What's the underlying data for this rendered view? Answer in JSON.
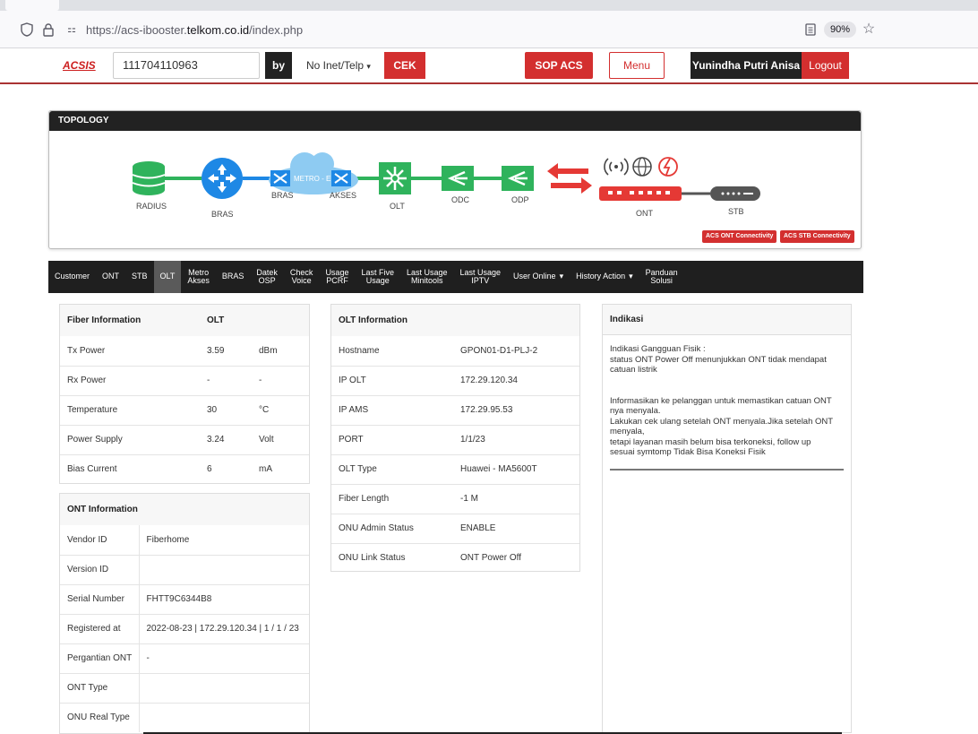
{
  "browser": {
    "url_prefix": "https://acs-ibooster.",
    "url_domain": "telkom.co.id",
    "url_path": "/index.php",
    "zoom": "90%"
  },
  "nav": {
    "logo": "ACSIS",
    "search_value": "111704110963",
    "by_label": "by",
    "select_value": "No Inet/Telp",
    "cek_label": "CEK",
    "sop_label": "SOP ACS",
    "menu_label": "Menu",
    "user_name": "Yunindha Putri Anisa",
    "logout_label": "Logout"
  },
  "topology": {
    "title": "TOPOLOGY",
    "labels": {
      "radius": "RADIUS",
      "bras": "BRAS",
      "metro_bras": "BRAS",
      "metro": "METRO - E",
      "metro_akses": "AKSES",
      "olt": "OLT",
      "odc": "ODC",
      "odp": "ODP",
      "ont": "ONT",
      "stb": "STB"
    },
    "badges": [
      "ACS ONT Connectivity",
      "ACS STB Connectivity"
    ],
    "colors": {
      "green": "#2fb35c",
      "blue": "#1e88e5",
      "red": "#e53935",
      "cloud": "#8ecbf2"
    }
  },
  "tabs": [
    {
      "label": "Customer",
      "active": false,
      "dropdown": false
    },
    {
      "label": "ONT",
      "active": false,
      "dropdown": false
    },
    {
      "label": "STB",
      "active": false,
      "dropdown": false
    },
    {
      "label": "OLT",
      "active": true,
      "dropdown": false
    },
    {
      "label": "Metro\nAkses",
      "active": false,
      "dropdown": false
    },
    {
      "label": "BRAS",
      "active": false,
      "dropdown": false
    },
    {
      "label": "Datek\nOSP",
      "active": false,
      "dropdown": false
    },
    {
      "label": "Check\nVoice",
      "active": false,
      "dropdown": false
    },
    {
      "label": "Usage\nPCRF",
      "active": false,
      "dropdown": false
    },
    {
      "label": "Last Five\nUsage",
      "active": false,
      "dropdown": false
    },
    {
      "label": "Last Usage\nMinitools",
      "active": false,
      "dropdown": false
    },
    {
      "label": "Last Usage\nIPTV",
      "active": false,
      "dropdown": false
    },
    {
      "label": "User Online",
      "active": false,
      "dropdown": true
    },
    {
      "label": "History Action",
      "active": false,
      "dropdown": true
    },
    {
      "label": "Panduan\nSolusi",
      "active": false,
      "dropdown": false
    }
  ],
  "fiber": {
    "header": [
      "Fiber Information",
      "OLT",
      ""
    ],
    "rows": [
      [
        "Tx Power",
        "3.59",
        "dBm"
      ],
      [
        "Rx Power",
        "-",
        "-"
      ],
      [
        "Temperature",
        "30",
        "°C"
      ],
      [
        "Power Supply",
        "3.24",
        "Volt"
      ],
      [
        "Bias Current",
        "6",
        "mA"
      ]
    ]
  },
  "ont_info": {
    "header": "ONT Information",
    "rows": [
      [
        "Vendor ID",
        "Fiberhome"
      ],
      [
        "Version ID",
        ""
      ],
      [
        "Serial Number",
        "FHTT9C6344B8"
      ],
      [
        "Registered at",
        "2022-08-23 | 172.29.120.34 | 1 / 1 / 23"
      ],
      [
        "Pergantian ONT",
        "-"
      ],
      [
        "ONT Type",
        ""
      ],
      [
        "ONU Real Type",
        ""
      ]
    ]
  },
  "olt_info": {
    "header": "OLT Information",
    "rows": [
      [
        "Hostname",
        "GPON01-D1-PLJ-2"
      ],
      [
        "IP OLT",
        "172.29.120.34"
      ],
      [
        "IP AMS",
        "172.29.95.53"
      ],
      [
        "PORT",
        "1/1/23"
      ],
      [
        "OLT Type",
        "Huawei - MA5600T"
      ],
      [
        "Fiber Length",
        "-1 M"
      ],
      [
        "ONU Admin Status",
        "ENABLE"
      ],
      [
        "ONU Link Status",
        "ONT Power Off"
      ]
    ]
  },
  "indikasi": {
    "title": "Indikasi",
    "p1": [
      "Indikasi Gangguan Fisik :",
      "status ONT Power Off menunjukkan ONT tidak mendapat",
      "catuan listrik"
    ],
    "p2": [
      "Informasikan ke pelanggan untuk memastikan catuan ONT",
      "nya menyala.",
      "Lakukan cek ulang setelah ONT menyala.Jika setelah ONT",
      "menyala,",
      "tetapi layanan masih belum bisa terkoneksi, follow up",
      "sesuai symtomp Tidak Bisa Koneksi Fisik"
    ]
  }
}
